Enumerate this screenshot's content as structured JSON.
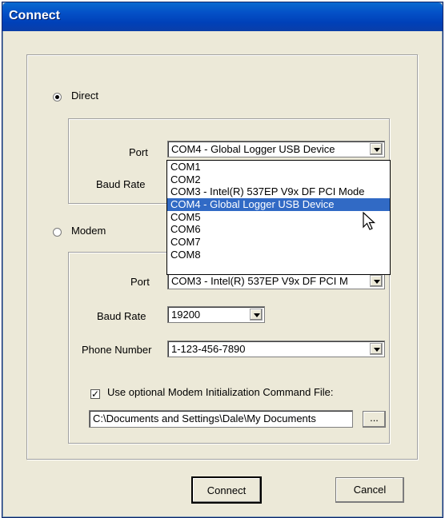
{
  "window": {
    "title": "Connect"
  },
  "direct": {
    "radio_label": "Direct",
    "selected": true,
    "port_label": "Port",
    "port_value": "COM4 - Global Logger USB Device",
    "baud_label": "Baud Rate"
  },
  "port_dropdown": {
    "options": [
      "COM1",
      "COM2",
      "COM3 - Intel(R) 537EP V9x DF PCI Mode",
      "COM4 - Global Logger USB Device",
      "COM5",
      "COM6",
      "COM7",
      "COM8"
    ],
    "selected_index": 3
  },
  "modem": {
    "radio_label": "Modem",
    "selected": false,
    "port_label": "Port",
    "port_value": "COM3 - Intel(R) 537EP V9x DF PCI M",
    "baud_label": "Baud Rate",
    "baud_value": "19200",
    "phone_label": "Phone Number",
    "phone_value": "1-123-456-7890",
    "init_checkbox_label": "Use optional Modem Initialization Command File:",
    "init_checked": true,
    "init_path": "C:\\Documents and Settings\\Dale\\My Documents",
    "browse_label": "..."
  },
  "buttons": {
    "connect": "Connect",
    "cancel": "Cancel"
  }
}
